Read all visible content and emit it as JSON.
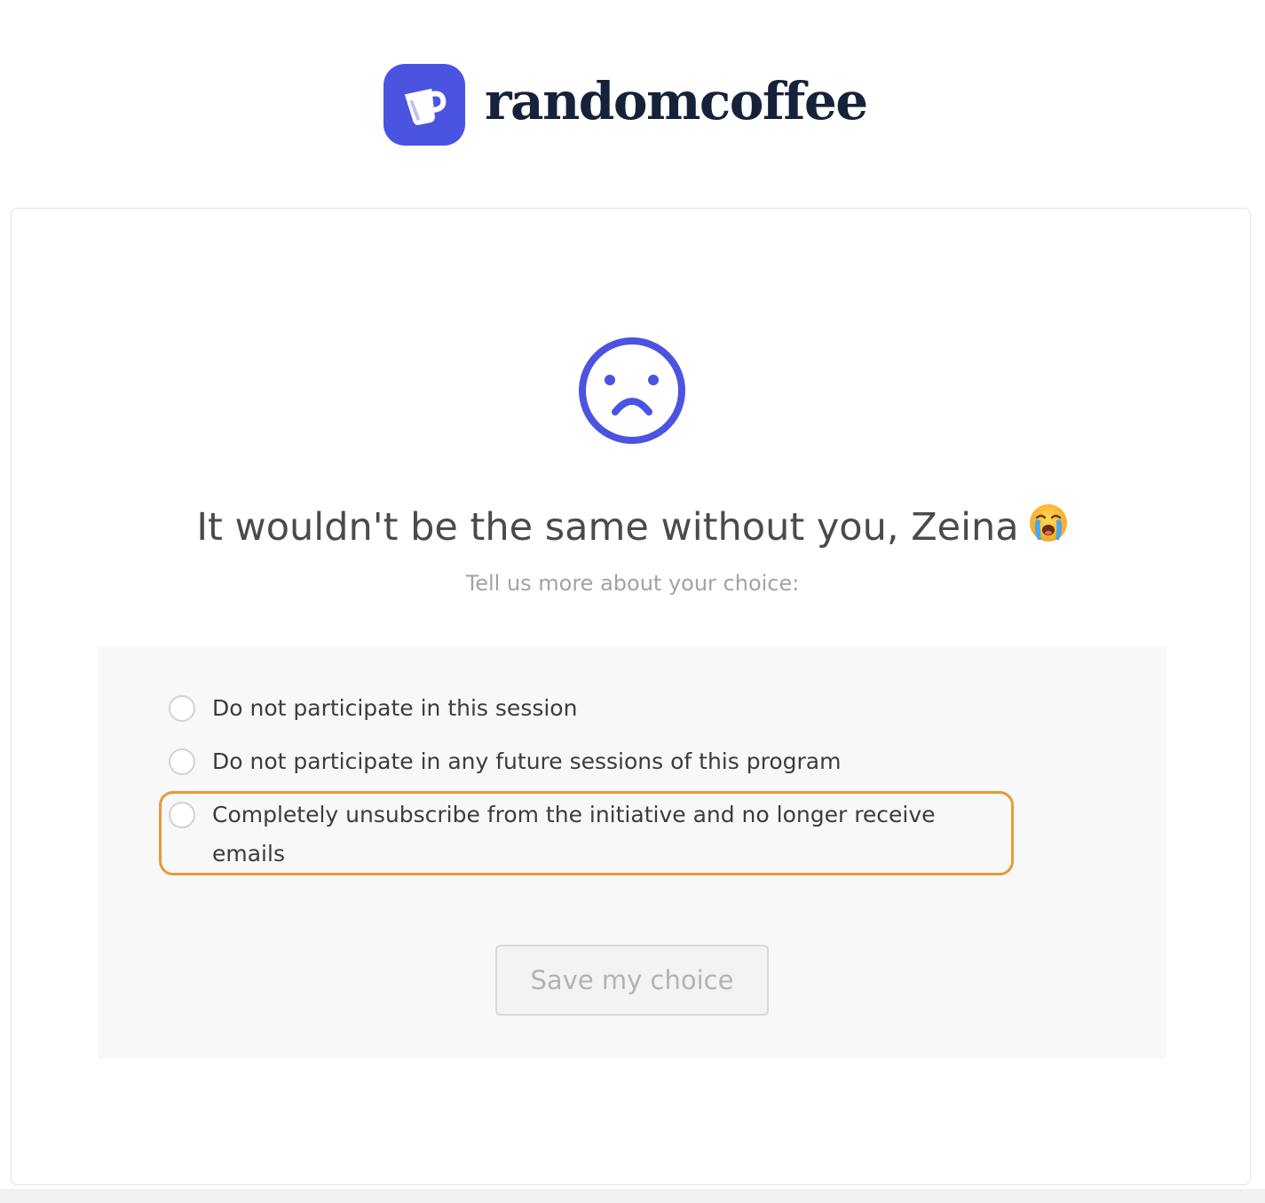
{
  "brand": {
    "name": "randomcoffee",
    "logo_icon": "coffee-cup-icon",
    "accent_color": "#4b54e0",
    "text_color": "#16213a"
  },
  "main": {
    "icon": "sad-face-icon",
    "title": "It wouldn't be the same without you, Zeina",
    "title_emoji": "loudly-crying-face-icon",
    "subtitle": "Tell us more about your choice:"
  },
  "options": [
    {
      "label": "Do not participate in this session",
      "selected": false
    },
    {
      "label": "Do not participate in any future sessions of this program",
      "selected": false
    },
    {
      "label": "Completely unsubscribe from the initiative and no longer receive emails",
      "selected": false,
      "highlighted": true
    }
  ],
  "highlight_color": "#e9983a",
  "save_button": {
    "label": "Save my choice",
    "disabled": true
  }
}
